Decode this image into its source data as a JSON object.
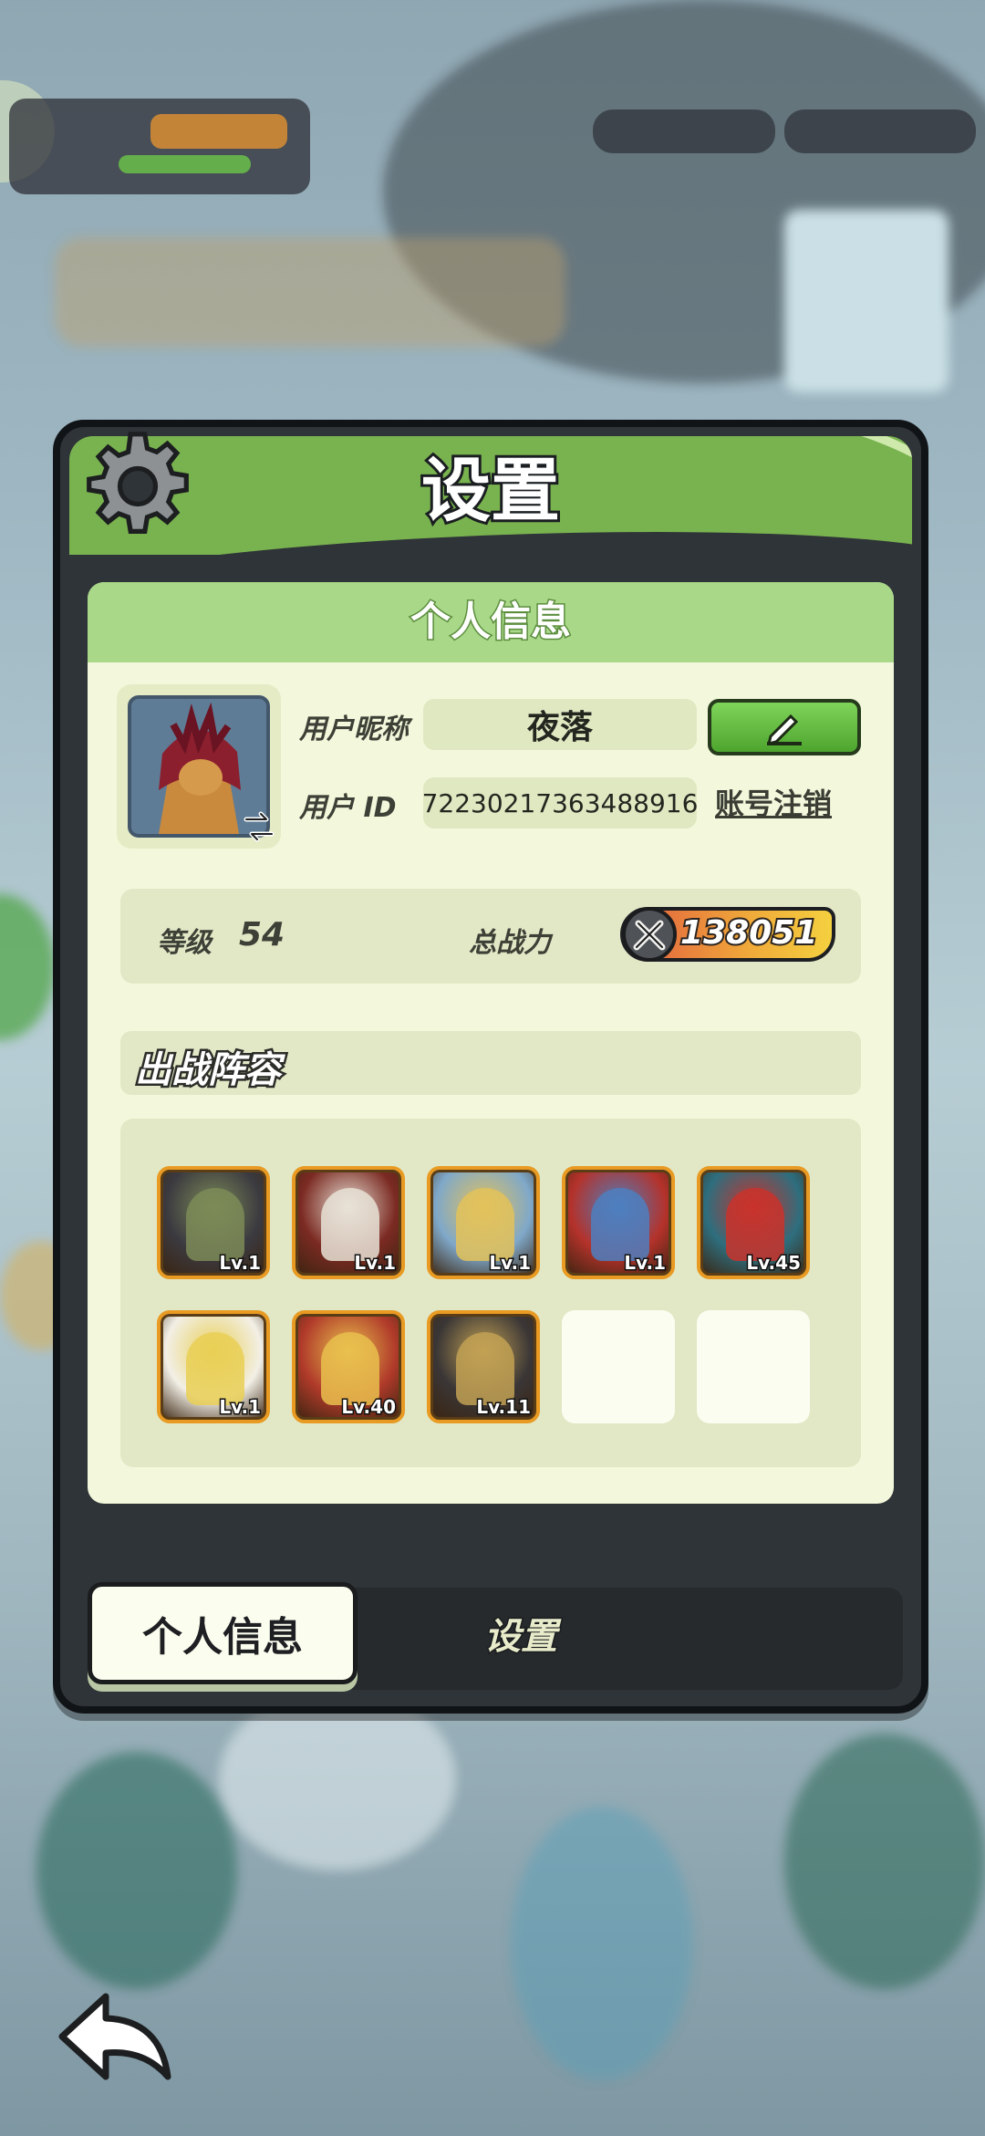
{
  "window": {
    "title": "设置"
  },
  "panel": {
    "title": "个人信息"
  },
  "profile": {
    "nickname_label": "用户昵称",
    "nickname": "夜落",
    "id_label": "用户 ID",
    "user_id": "72230217363488916",
    "logout_label": "账号注销",
    "level_label": "等级",
    "level": "54",
    "power_label": "总战力",
    "power": "138051"
  },
  "lineup": {
    "title": "出战阵容",
    "heroes": [
      {
        "level": "Lv.1",
        "color": "#3b3a40",
        "accent": "#7c8b57"
      },
      {
        "level": "Lv.1",
        "color": "#7b2a22",
        "accent": "#e8e2d6"
      },
      {
        "level": "Lv.1",
        "color": "#7fa8c9",
        "accent": "#e3c25b"
      },
      {
        "level": "Lv.1",
        "color": "#b4322b",
        "accent": "#4d7fbf"
      },
      {
        "level": "Lv.45",
        "color": "#2e6e7e",
        "accent": "#c9322c"
      },
      {
        "level": "Lv.1",
        "color": "#f2efe6",
        "accent": "#e9cf55"
      },
      {
        "level": "Lv.40",
        "color": "#b03a2a",
        "accent": "#e9c04d"
      },
      {
        "level": "Lv.11",
        "color": "#3a3636",
        "accent": "#c2a154"
      }
    ],
    "empty_slots": 2
  },
  "tabs": {
    "active": "个人信息",
    "inactive": "设置"
  },
  "colors": {
    "header_green": "#79b34f",
    "panel_bg": "#f3f8dc",
    "hero_border": "#e89a22",
    "edit_button": "#5cb838"
  },
  "icons": [
    "gear-icon",
    "swap-icon",
    "pencil-icon",
    "sword-icon",
    "back-arrow-icon"
  ]
}
